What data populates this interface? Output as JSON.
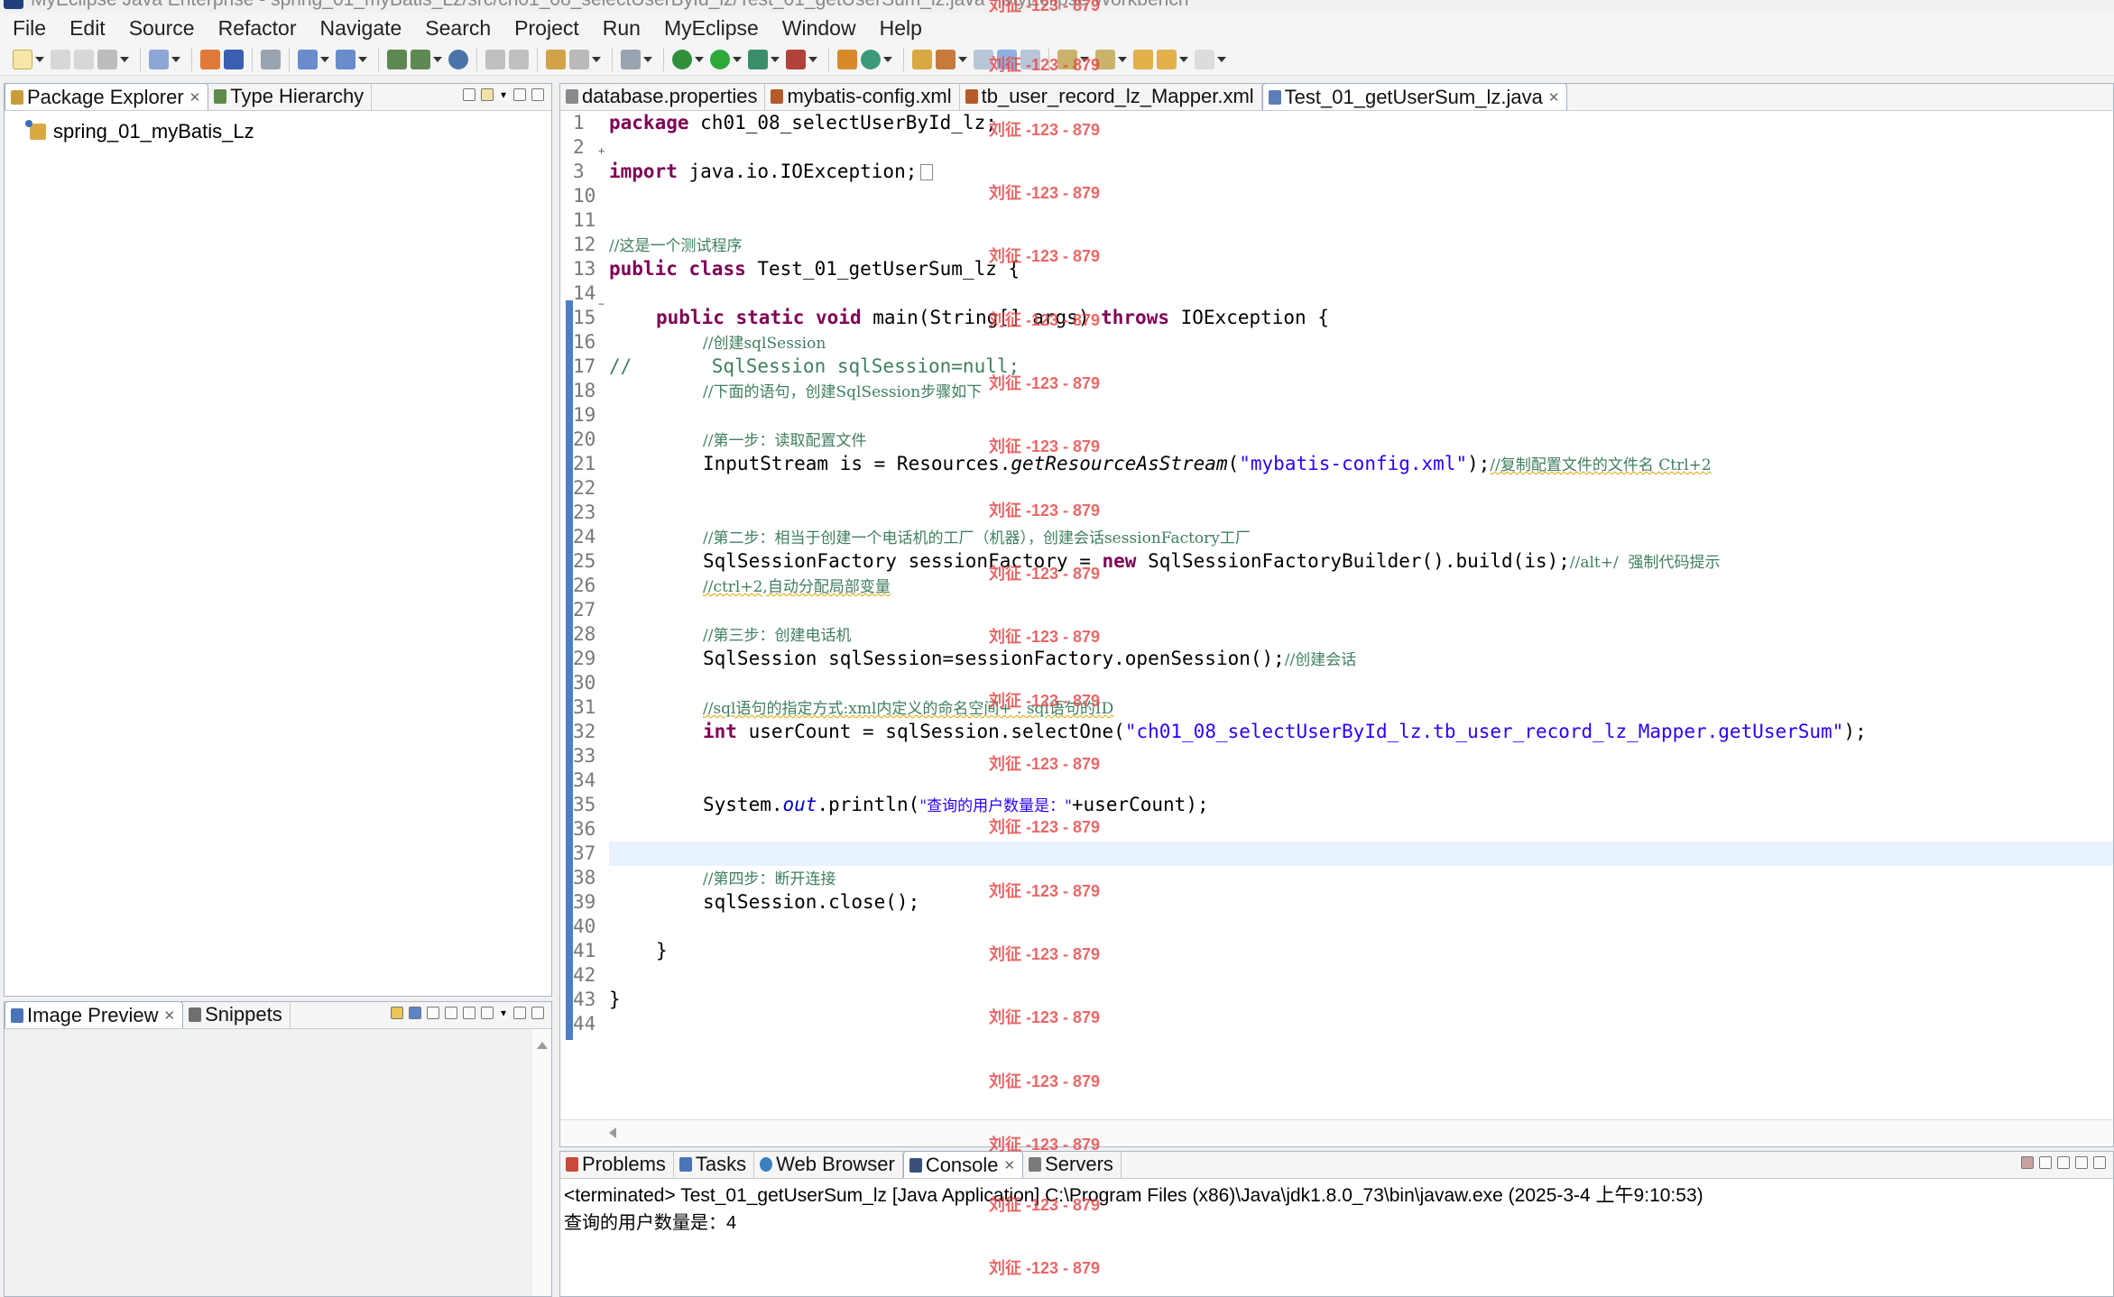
{
  "window": {
    "title": "MyEclipse Java Enterprise - spring_01_myBatis_Lz/src/ch01_08_selectUserById_lz/Test_01_getUserSum_lz.java - MyEclipse Workbench"
  },
  "menu": [
    "File",
    "Edit",
    "Source",
    "Refactor",
    "Navigate",
    "Search",
    "Project",
    "Run",
    "MyEclipse",
    "Window",
    "Help"
  ],
  "left_top": {
    "tabs": [
      {
        "label": "Package Explorer"
      },
      {
        "label": "Type Hierarchy"
      }
    ],
    "tree": [
      {
        "label": "spring_01_myBatis_Lz"
      }
    ]
  },
  "left_bottom": {
    "tabs": [
      {
        "label": "Image Preview"
      },
      {
        "label": "Snippets"
      }
    ]
  },
  "editor": {
    "tabs": [
      {
        "label": "database.properties"
      },
      {
        "label": "mybatis-config.xml"
      },
      {
        "label": "tb_user_record_lz_Mapper.xml"
      },
      {
        "label": "Test_01_getUserSum_lz.java"
      }
    ],
    "line_numbers": [
      "1",
      "2",
      "3",
      "10",
      "11",
      "12",
      "13",
      "14",
      "15",
      "16",
      "17",
      "18",
      "19",
      "20",
      "21",
      "22",
      "23",
      "24",
      "25",
      "26",
      "27",
      "28",
      "29",
      "30",
      "31",
      "32",
      "33",
      "34",
      "35",
      "36",
      "37",
      "38",
      "39",
      "40",
      "41",
      "42",
      "43",
      "44"
    ],
    "code": {
      "l1_kw": "package",
      "l1_rest": " ch01_08_selectUserById_lz;",
      "l3_kw": "import",
      "l3_rest": " java.io.IOException;",
      "l12_cmt": "//这是一个测试程序",
      "l13_kw1": "public",
      "l13_kw2": "class",
      "l13_rest": " Test_01_getUserSum_lz {",
      "l15_kw1": "public",
      "l15_kw2": "static",
      "l15_kw3": "void",
      "l15_mid": " main(String[] args) ",
      "l15_kw4": "throws",
      "l15_rest": " IOException {",
      "l16_cmt": "//创建sqlSession",
      "l17_cmt": "//       SqlSession sqlSession=null;",
      "l18_cmt": "//下面的语句，创建SqlSession步骤如下",
      "l20_cmt": "//第一步：读取配置文件",
      "l21_a": "InputStream is = Resources.",
      "l21_it": "getResourceAsStream",
      "l21_b": "(",
      "l21_str": "\"mybatis-config.xml\"",
      "l21_c": ");",
      "l21_cmt": "//复制配置文件的文件名 Ctrl+2",
      "l24_cmt": "//第二步：相当于创建一个电话机的工厂（机器），创建会话sessionFactory工厂",
      "l25_a": "SqlSessionFactory sessionFactory = ",
      "l25_kw": "new",
      "l25_b": " SqlSessionFactoryBuilder().build(is);",
      "l25_cmt": "//alt+/  强制代码提示",
      "l26_cmt": "//ctrl+2,自动分配局部变量",
      "l28_cmt": "//第三步：创建电话机",
      "l29_a": "SqlSession sqlSession=sessionFactory.openSession();",
      "l29_cmt": "//创建会话",
      "l31_cmt": "//sql语句的指定方式:xml内定义的命名空间+ . sql语句的ID",
      "l32_kw": "int",
      "l32_a": " userCount = sqlSession.selectOne(",
      "l32_str": "\"ch01_08_selectUserById_lz.tb_user_record_lz_Mapper.getUserSum\"",
      "l32_b": ");",
      "l35_a": "System.",
      "l35_fld": "out",
      "l35_b": ".println(",
      "l35_str": "\"查询的用户数量是：\"",
      "l35_c": "+userCount);",
      "l38_cmt": "//第四步：断开连接",
      "l39_a": "sqlSession.close();",
      "l41_a": "}",
      "l43_a": "}"
    }
  },
  "bottom": {
    "tabs": [
      {
        "label": "Problems"
      },
      {
        "label": "Tasks"
      },
      {
        "label": "Web Browser"
      },
      {
        "label": "Console"
      },
      {
        "label": "Servers"
      }
    ],
    "console": {
      "header": "<terminated> Test_01_getUserSum_lz [Java Application] C:\\Program Files (x86)\\Java\\jdk1.8.0_73\\bin\\javaw.exe (2025-3-4 上午9:10:53)",
      "output": "查询的用户数量是：4"
    }
  },
  "watermark": "刘征 -123 - 879",
  "colors": {
    "keyword": "#7f0055",
    "string": "#2a00ff",
    "comment": "#3f7f5f",
    "highlight": "#e8f2fe",
    "watermark": "#e64646"
  }
}
